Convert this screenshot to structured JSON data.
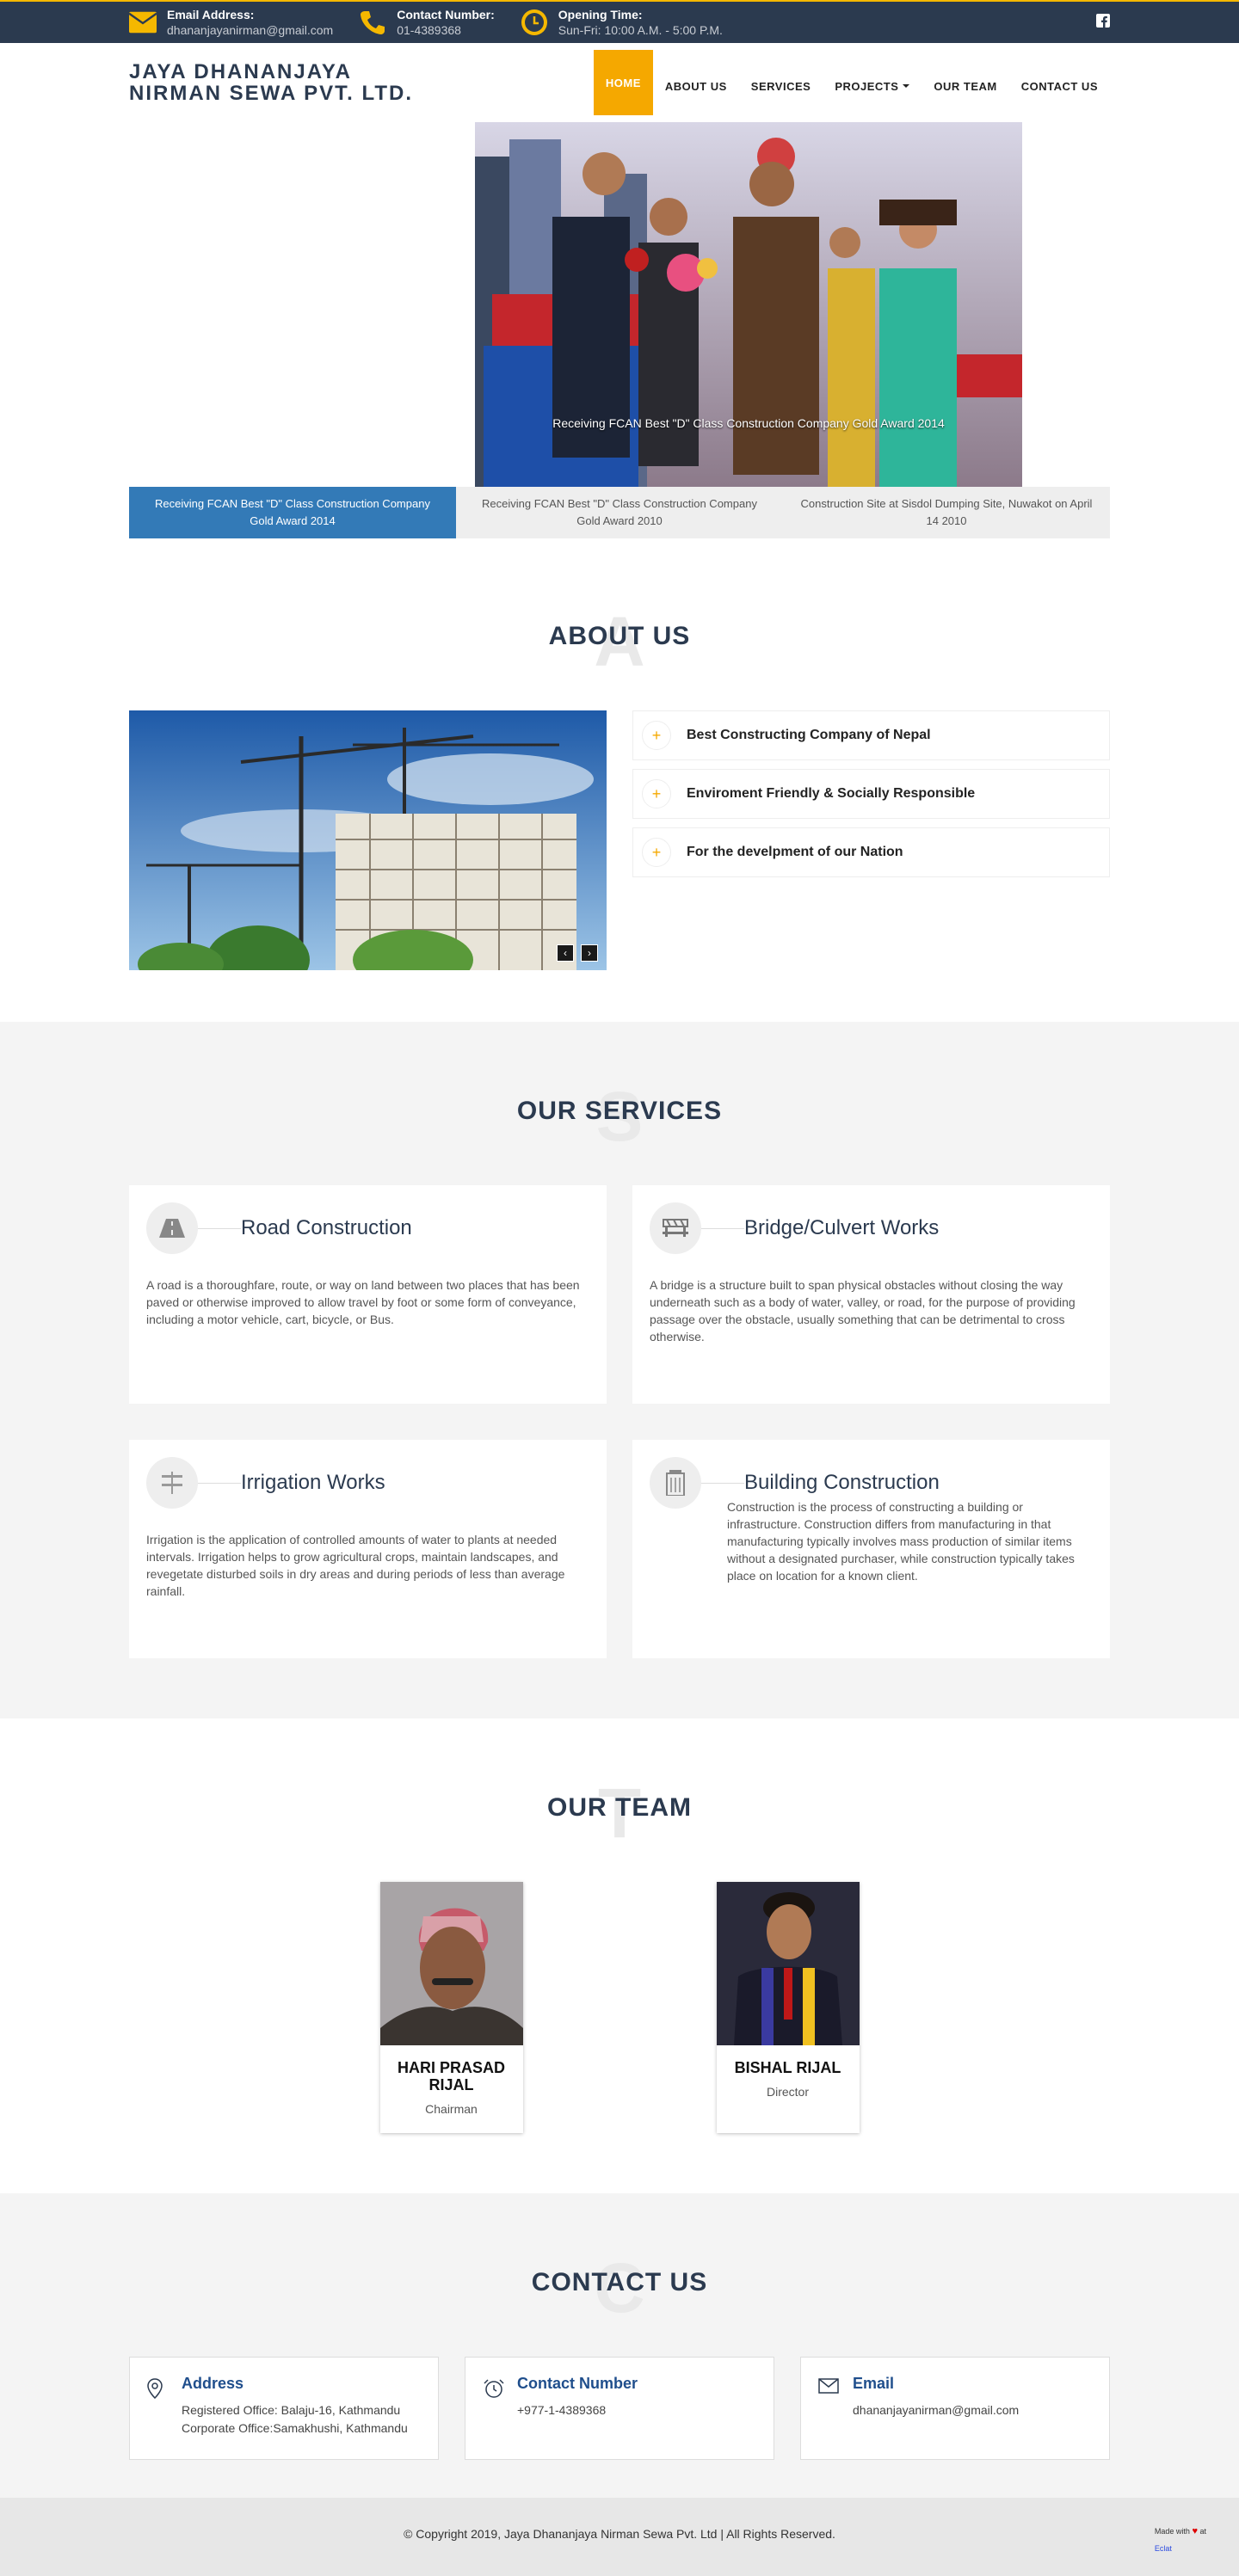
{
  "topbar": {
    "email_label": "Email Address:",
    "email_value": "dhananjayanirman@gmail.com",
    "phone_label": "Contact Number:",
    "phone_value": "01-4389368",
    "hours_label": "Opening Time:",
    "hours_value": "Sun-Fri: 10:00 A.M. - 5:00 P.M.",
    "social_icon": "facebook-square-icon"
  },
  "brand": {
    "line1": "JAYA DHANANJAYA",
    "line2": "NIRMAN SEWA PVT. LTD."
  },
  "nav": {
    "items": [
      {
        "label": "HOME",
        "active": true
      },
      {
        "label": "ABOUT US",
        "active": false
      },
      {
        "label": "SERVICES",
        "active": false
      },
      {
        "label": "PROJECTS",
        "active": false,
        "dropdown": true
      },
      {
        "label": "OUR TEAM",
        "active": false
      },
      {
        "label": "CONTACT US",
        "active": false
      }
    ]
  },
  "slider": {
    "caption": "Receiving FCAN Best \"D\" Class Construction Company Gold Award 2014",
    "tabs": [
      "Receiving FCAN Best \"D\" Class Construction Company Gold Award 2014",
      "Receiving FCAN Best \"D\" Class Construction Company Gold Award 2010",
      "Construction Site at Sisdol Dumping Site, Nuwakot on April 14 2010"
    ]
  },
  "about": {
    "ghost": "A",
    "title": "ABOUT US",
    "items": [
      "Best Constructing Company of Nepal",
      "Enviroment Friendly & Socially Responsible",
      "For the develpment of our Nation"
    ]
  },
  "services": {
    "ghost": "S",
    "title": "OUR SERVICES",
    "items": [
      {
        "title": "Road Construction",
        "icon": "road-icon",
        "desc": "A road is a thoroughfare, route, or way on land between two places that has been paved or otherwise improved to allow travel by foot or some form of conveyance, including a motor vehicle, cart, bicycle, or Bus."
      },
      {
        "title": "Bridge/Culvert Works",
        "icon": "barrier-icon",
        "desc": "A bridge is a structure built to span physical obstacles without closing the way underneath such as a body of water, valley, or road, for the purpose of providing passage over the obstacle, usually something that can be detrimental to cross otherwise."
      },
      {
        "title": "Irrigation Works",
        "icon": "signpost-icon",
        "desc": "Irrigation is the application of controlled amounts of water to plants at needed intervals. Irrigation helps to grow agricultural crops, maintain landscapes, and revegetate disturbed soils in dry areas and during periods of less than average rainfall."
      },
      {
        "title": "Building Construction",
        "icon": "building-icon",
        "desc": "Construction is the process of constructing a building or infrastructure. Construction differs from manufacturing in that manufacturing typically involves mass production of similar items without a designated purchaser, while construction typically takes place on location for a known client."
      }
    ]
  },
  "team": {
    "ghost": "T",
    "title": "OUR TEAM",
    "members": [
      {
        "name": "HARI PRASAD RIJAL",
        "role": "Chairman"
      },
      {
        "name": "BISHAL RIJAL",
        "role": "Director"
      }
    ]
  },
  "contact": {
    "ghost": "C",
    "title": "CONTACT US",
    "address_title": "Address",
    "address_line1": "Registered Office: Balaju-16, Kathmandu",
    "address_line2": "Corporate Office:Samakhushi, Kathmandu",
    "phone_title": "Contact Number",
    "phone_value": "+977-1-4389368",
    "email_title": "Email",
    "email_value": "dhananjayanirman@gmail.com"
  },
  "footer": {
    "copyright": "© Copyright 2019, Jaya Dhananjaya Nirman Sewa Pvt. Ltd | All Rights Reserved.",
    "made_prefix": "Made with",
    "made_suffix": "at",
    "made_link": "Eclat"
  },
  "colors": {
    "topbar_bg": "#2b3a4f",
    "accent": "#f5a800",
    "active_tab": "#337ab7",
    "heading": "#2b3a4f"
  }
}
